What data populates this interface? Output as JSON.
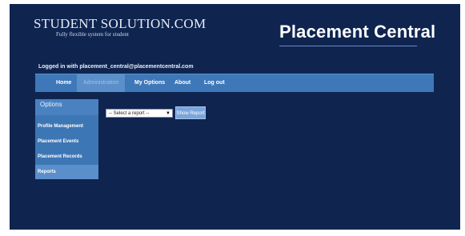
{
  "header": {
    "brand_name": "STUDENT SOLUTION.COM",
    "brand_tagline": "Fully flexible system for student",
    "site_title": "Placement Central",
    "logged_in_text": "Logged in with placement_central@placementcentral.com"
  },
  "nav": {
    "items": [
      {
        "label": "Home"
      },
      {
        "label": "Administration"
      },
      {
        "label": "My Options"
      },
      {
        "label": "About"
      },
      {
        "label": "Log out"
      }
    ],
    "active": "Administration"
  },
  "sidebar": {
    "heading": "Options",
    "items": [
      {
        "label": "Profile Management"
      },
      {
        "label": "Placement Events"
      },
      {
        "label": "Placement Records"
      },
      {
        "label": "Reports"
      }
    ],
    "active": "Reports"
  },
  "report": {
    "select_value": "-- Select a report --",
    "show_button": "Show Report"
  },
  "colors": {
    "background": "#0f2550",
    "nav": "#3e78b8",
    "nav_active": "#5b8fca",
    "sidebar": "#3d76b4",
    "button": "#7aa6dc"
  }
}
